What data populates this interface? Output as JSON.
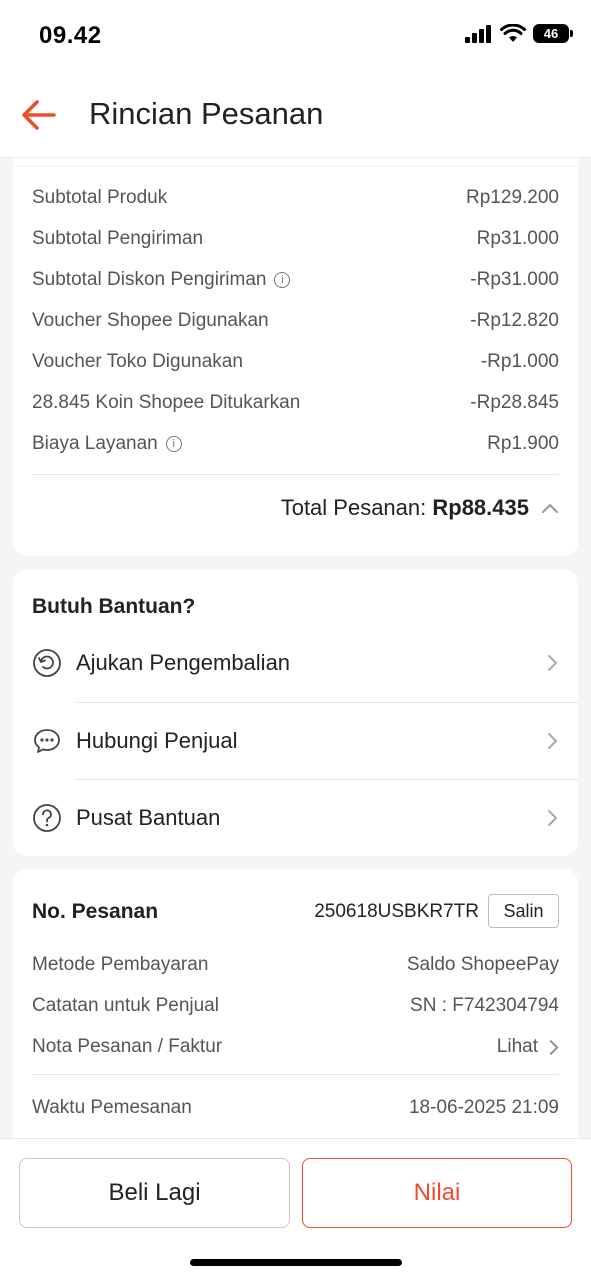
{
  "status_bar": {
    "time": "09.42",
    "battery": "46"
  },
  "header": {
    "title": "Rincian Pesanan"
  },
  "payment_summary": {
    "rows": [
      {
        "label": "Subtotal Produk",
        "value": "Rp129.200",
        "info": false
      },
      {
        "label": "Subtotal Pengiriman",
        "value": "Rp31.000",
        "info": false
      },
      {
        "label": "Subtotal Diskon Pengiriman",
        "value": "-Rp31.000",
        "info": true
      },
      {
        "label": "Voucher Shopee Digunakan",
        "value": "-Rp12.820",
        "info": false
      },
      {
        "label": "Voucher Toko Digunakan",
        "value": "-Rp1.000",
        "info": false
      },
      {
        "label": "28.845 Koin Shopee Ditukarkan",
        "value": "-Rp28.845",
        "info": false
      },
      {
        "label": "Biaya Layanan",
        "value": "Rp1.900",
        "info": true
      }
    ],
    "total_label": "Total Pesanan:",
    "total_value": "Rp88.435"
  },
  "help": {
    "title": "Butuh Bantuan?",
    "items": [
      {
        "label": "Ajukan Pengembalian",
        "icon": "return-icon"
      },
      {
        "label": "Hubungi Penjual",
        "icon": "chat-icon"
      },
      {
        "label": "Pusat Bantuan",
        "icon": "help-icon"
      }
    ]
  },
  "order_info": {
    "order_no_label": "No. Pesanan",
    "order_no_value": "250618USBKR7TR",
    "copy_label": "Salin",
    "rows": [
      {
        "label": "Metode Pembayaran",
        "value": "Saldo ShopeePay"
      },
      {
        "label": "Catatan untuk Penjual",
        "value": "SN : F742304794"
      },
      {
        "label": "Nota Pesanan / Faktur",
        "value": "Lihat"
      }
    ],
    "order_time_label": "Waktu Pemesanan",
    "order_time_value": "18-06-2025 21:09"
  },
  "actions": {
    "buy_again": "Beli Lagi",
    "rate": "Nilai"
  },
  "colors": {
    "accent": "#ee4d2d"
  }
}
